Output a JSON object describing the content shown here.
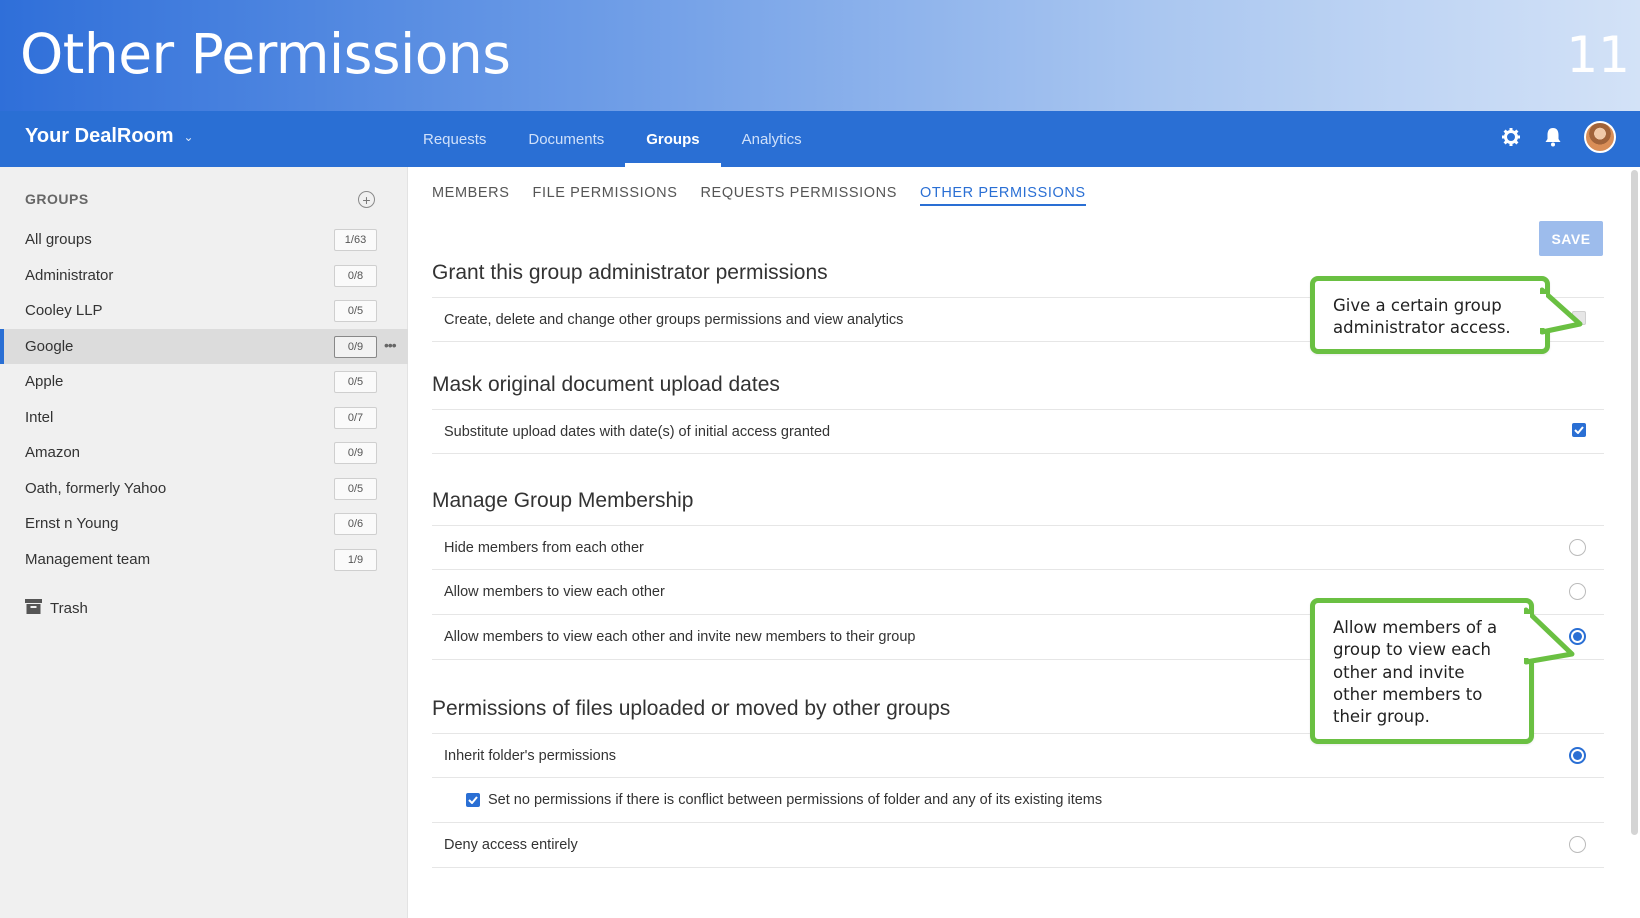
{
  "slide": {
    "title": "Other Permissions",
    "number": "11"
  },
  "navbar": {
    "brand": "Your DealRoom",
    "tabs": [
      {
        "label": "Requests"
      },
      {
        "label": "Documents"
      },
      {
        "label": "Groups"
      },
      {
        "label": "Analytics"
      }
    ],
    "active_tab": "Groups"
  },
  "sidebar": {
    "heading": "GROUPS",
    "groups": [
      {
        "name": "All groups",
        "count": "1/63"
      },
      {
        "name": "Administrator",
        "count": "0/8"
      },
      {
        "name": "Cooley LLP",
        "count": "0/5"
      },
      {
        "name": "Google",
        "count": "0/9"
      },
      {
        "name": "Apple",
        "count": "0/5"
      },
      {
        "name": "Intel",
        "count": "0/7"
      },
      {
        "name": "Amazon",
        "count": "0/9"
      },
      {
        "name": "Oath, formerly Yahoo",
        "count": "0/5"
      },
      {
        "name": "Ernst n Young",
        "count": "0/6"
      },
      {
        "name": "Management team",
        "count": "1/9"
      }
    ],
    "active_group": "Google",
    "trash_label": "Trash"
  },
  "content": {
    "sub_tabs": [
      {
        "label": "MEMBERS"
      },
      {
        "label": "FILE PERMISSIONS"
      },
      {
        "label": "REQUESTS PERMISSIONS"
      },
      {
        "label": "OTHER PERMISSIONS"
      }
    ],
    "active_sub_tab": "OTHER PERMISSIONS",
    "save_label": "SAVE",
    "sections": [
      {
        "title": "Grant this group administrator permissions",
        "rows": [
          {
            "label": "Create, delete and change other groups permissions and view analytics",
            "control": "checkbox",
            "checked": false
          }
        ]
      },
      {
        "title": "Mask original document upload dates",
        "rows": [
          {
            "label": "Substitute upload dates with date(s) of initial access granted",
            "control": "checkbox",
            "checked": true
          }
        ]
      },
      {
        "title": "Manage Group Membership",
        "rows": [
          {
            "label": "Hide members from each other",
            "control": "radio",
            "checked": false
          },
          {
            "label": "Allow members to view each other",
            "control": "radio",
            "checked": false
          },
          {
            "label": "Allow members to view each other and invite new members to their group",
            "control": "radio",
            "checked": true
          }
        ]
      },
      {
        "title": "Permissions of files uploaded or moved by other groups",
        "rows": [
          {
            "label": "Inherit folder's permissions",
            "control": "radio",
            "checked": true
          },
          {
            "label": "Set no permissions if there is conflict between permissions of folder and any of its existing items",
            "control": "inline-checkbox",
            "checked": true
          },
          {
            "label": "Deny access entirely",
            "control": "radio",
            "checked": false
          }
        ]
      }
    ]
  },
  "callouts": [
    {
      "text": "Give a certain group administrator access."
    },
    {
      "text": "Allow members of a group to view each other and invite other members to their group."
    }
  ],
  "colors": {
    "accent": "#2a6fd4",
    "callout_border": "#6ac042",
    "sidebar_bg": "#f0f0f0",
    "save_button": "#9dbcec"
  }
}
